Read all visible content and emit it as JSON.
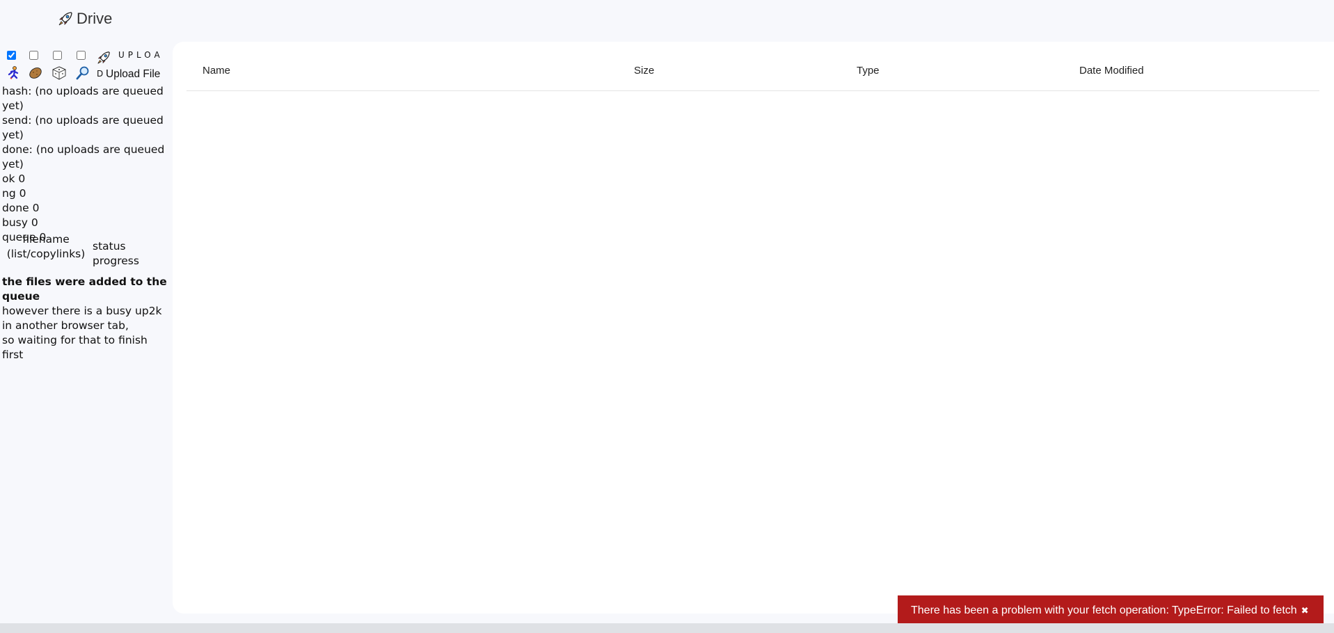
{
  "header": {
    "app_title": "Drive",
    "icon": "rocket-icon"
  },
  "uploader": {
    "toggles": [
      {
        "name": "run-toggle",
        "checked": true,
        "icon": "running-man-icon"
      },
      {
        "name": "potato-toggle",
        "checked": false,
        "icon": "potato-icon"
      },
      {
        "name": "random-toggle",
        "checked": false,
        "icon": "dice-icon"
      },
      {
        "name": "search-toggle",
        "checked": false,
        "icon": "magnifier-icon"
      }
    ],
    "upload_button_letters": "UPLOA",
    "upload_button_letter_d": "D",
    "upload_file_label": "Upload File",
    "stats": [
      "hash: (no uploads are queued yet)",
      "send: (no uploads are queued yet)",
      "done: (no uploads are queued yet)",
      "ok 0",
      "ng 0",
      "done 0",
      "busy 0",
      "queue 0"
    ],
    "table_header": {
      "filename": "filename",
      "filename_sub": "(list/copylinks)",
      "status_progress": "status progress"
    },
    "message": {
      "title": "the files were added to the queue",
      "line1": "however there is a busy up2k in another browser tab,",
      "line2": "so waiting for that to finish first"
    }
  },
  "file_table": {
    "columns": [
      "Name",
      "Size",
      "Type",
      "Date Modified"
    ],
    "rows": []
  },
  "toast": {
    "message": "There has been a problem with your fetch operation: TypeError: Failed to fetch",
    "close_glyph": "✖",
    "color": "#b31b1b"
  }
}
